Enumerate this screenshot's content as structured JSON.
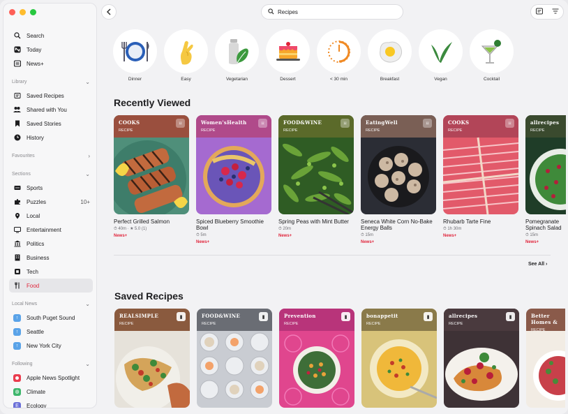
{
  "window": {
    "search_value": "Recipes"
  },
  "sidebar": {
    "top_items": [
      {
        "label": "Search",
        "icon": "search-icon"
      },
      {
        "label": "Today",
        "icon": "news-icon"
      },
      {
        "label": "News+",
        "icon": "news-plus-icon"
      }
    ],
    "library_header": "Library",
    "library_items": [
      {
        "label": "Saved Recipes"
      },
      {
        "label": "Shared with You"
      },
      {
        "label": "Saved Stories"
      },
      {
        "label": "History"
      }
    ],
    "favourites_header": "Favourites",
    "sections_header": "Sections",
    "section_items": [
      {
        "label": "Sports"
      },
      {
        "label": "Puzzles",
        "badge": "10+"
      },
      {
        "label": "Local"
      },
      {
        "label": "Entertainment"
      },
      {
        "label": "Politics"
      },
      {
        "label": "Business"
      },
      {
        "label": "Tech"
      },
      {
        "label": "Food"
      }
    ],
    "local_header": "Local News",
    "local_items": [
      {
        "label": "South Puget Sound"
      },
      {
        "label": "Seattle"
      },
      {
        "label": "New York City"
      }
    ],
    "following_header": "Following",
    "following_items": [
      {
        "label": "Apple News Spotlight"
      },
      {
        "label": "Climate"
      },
      {
        "label": "Ecology"
      }
    ]
  },
  "categories": [
    {
      "label": "Dinner",
      "icon": "dinner-plate-icon"
    },
    {
      "label": "Easy",
      "icon": "fingers-crossed-icon"
    },
    {
      "label": "Vegetarian",
      "icon": "vegetarian-icon"
    },
    {
      "label": "Dessert",
      "icon": "cake-icon"
    },
    {
      "label": "< 30 min",
      "icon": "timer-icon"
    },
    {
      "label": "Breakfast",
      "icon": "egg-icon"
    },
    {
      "label": "Vegan",
      "icon": "vegan-leaf-icon"
    },
    {
      "label": "Cocktail",
      "icon": "cocktail-icon"
    }
  ],
  "recently_viewed": {
    "heading": "Recently Viewed",
    "see_all": "See All",
    "cards": [
      {
        "brand": "COOKS",
        "kind": "RECIPE",
        "title": "Perfect Grilled Salmon",
        "meta": "⏱ 40m · ★ 5.0 (1)",
        "news_plus": "News+"
      },
      {
        "brand": "Women'sHealth",
        "kind": "RECIPE",
        "title": "Spiced Blueberry Smoothie Bowl",
        "meta": "⏱ 5m",
        "news_plus": "News+"
      },
      {
        "brand": "FOOD&WINE",
        "kind": "RECIPE",
        "title": "Spring Peas with Mint Butter",
        "meta": "⏱ 20m",
        "news_plus": "News+"
      },
      {
        "brand": "EatingWell",
        "kind": "RECIPE",
        "title": "Seneca White Corn No-Bake Energy Balls",
        "meta": "⏱ 15m",
        "news_plus": "News+"
      },
      {
        "brand": "COOKS",
        "kind": "RECIPE",
        "title": "Rhubarb Tarte Fine",
        "meta": "⏱ 1h 30m",
        "news_plus": "News+"
      },
      {
        "brand": "allrecipes",
        "kind": "RECIPE",
        "title": "Pomegranate Spinach Salad",
        "meta": "⏱ 15m",
        "news_plus": "News+"
      }
    ]
  },
  "saved_recipes": {
    "heading": "Saved Recipes",
    "cards": [
      {
        "brand": "REALSIMPLE",
        "kind": "RECIPE"
      },
      {
        "brand": "FOOD&WINE",
        "kind": "RECIPE"
      },
      {
        "brand": "Prevention",
        "kind": "RECIPE"
      },
      {
        "brand": "bonappetit",
        "kind": "RECIPE"
      },
      {
        "brand": "allrecipes",
        "kind": "RECIPE"
      },
      {
        "brand": "Better Homes &",
        "kind": "RECIPE"
      }
    ]
  },
  "colors": {
    "accent": "#e0243a",
    "sidebar_bg": "#f7f7f8",
    "content_bg": "#f2f2f4"
  }
}
